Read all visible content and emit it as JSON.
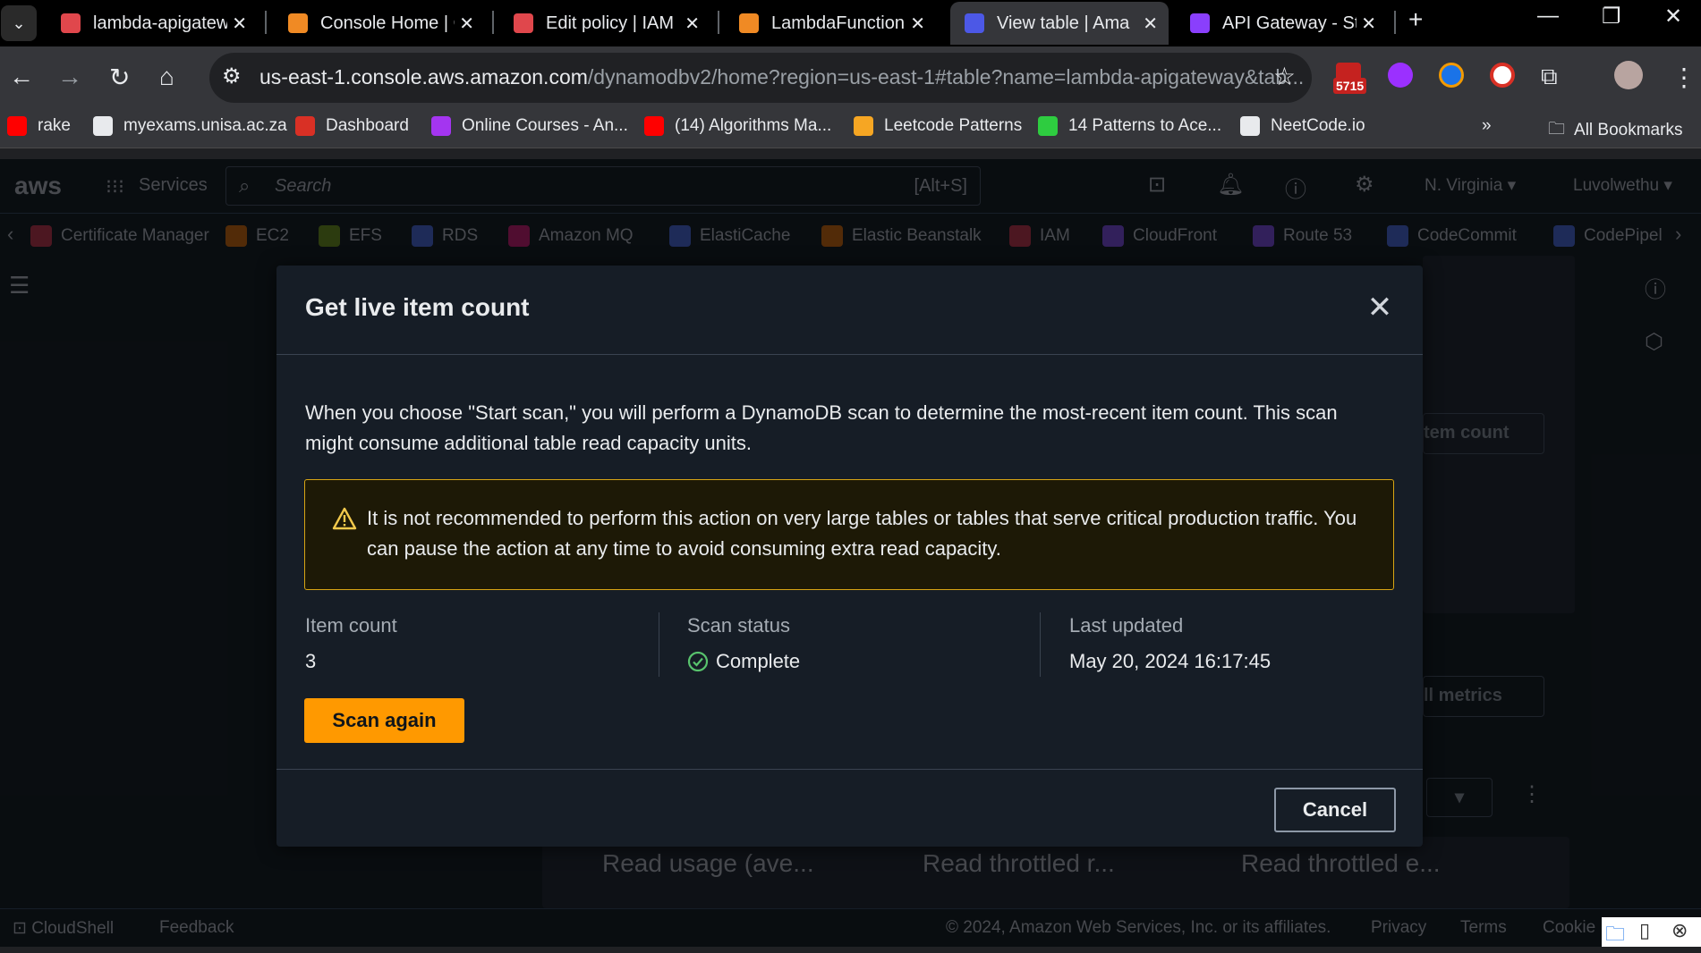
{
  "browser": {
    "tabs": [
      {
        "title": "lambda-apigatew",
        "color": "#e0474c"
      },
      {
        "title": "Console Home | C",
        "color": "#f08a24"
      },
      {
        "title": "Edit policy | IAM",
        "color": "#e0474c"
      },
      {
        "title": "LambdaFunction",
        "color": "#f08a24"
      },
      {
        "title": "View table | Ama",
        "color": "#4c58e6"
      },
      {
        "title": "API Gateway - St",
        "color": "#8a3ffc"
      }
    ],
    "url_host": "us-east-1.console.aws.amazon.com",
    "url_rest": "/dynamodbv2/home?region=us-east-1#table?name=lambda-apigateway&tab...",
    "badge": "5715",
    "bookmarks": [
      {
        "label": "rake",
        "color": "#ff0000"
      },
      {
        "label": "myexams.unisa.ac.za",
        "color": "#e8eaed"
      },
      {
        "label": "Dashboard",
        "color": "#d93025"
      },
      {
        "label": "Online Courses - An...",
        "color": "#a435f0"
      },
      {
        "label": "(14) Algorithms Ma...",
        "color": "#ff0000"
      },
      {
        "label": "Leetcode Patterns",
        "color": "#f6a623"
      },
      {
        "label": "14 Patterns to Ace...",
        "color": "#2ecc40"
      },
      {
        "label": "NeetCode.io",
        "color": "#e8eaed"
      }
    ],
    "all_bookmarks": "All Bookmarks"
  },
  "aws": {
    "services_label": "Services",
    "search_placeholder": "Search",
    "search_shortcut": "[Alt+S]",
    "region": "N. Virginia",
    "user": "Luvolwethu",
    "services": [
      {
        "label": "Certificate Manager",
        "color": "#dd344c"
      },
      {
        "label": "EC2",
        "color": "#ed7100"
      },
      {
        "label": "EFS",
        "color": "#7aa116"
      },
      {
        "label": "RDS",
        "color": "#4d72f3"
      },
      {
        "label": "Amazon MQ",
        "color": "#e7157b"
      },
      {
        "label": "ElastiCache",
        "color": "#4d72f3"
      },
      {
        "label": "Elastic Beanstalk",
        "color": "#ed7100"
      },
      {
        "label": "IAM",
        "color": "#dd344c"
      },
      {
        "label": "CloudFront",
        "color": "#8c4fff"
      },
      {
        "label": "Route 53",
        "color": "#8c4fff"
      },
      {
        "label": "CodeCommit",
        "color": "#4d72f3"
      },
      {
        "label": "CodePipel",
        "color": "#4d72f3"
      }
    ],
    "bg_btn_item_count": "tem count",
    "bg_btn_metrics": "ll metrics",
    "bg_cards": [
      "Read usage (ave...",
      "Read throttled r...",
      "Read throttled e..."
    ],
    "footer": {
      "cloudshell": "CloudShell",
      "feedback": "Feedback",
      "copyright": "© 2024, Amazon Web Services, Inc. or its affiliates.",
      "privacy": "Privacy",
      "terms": "Terms",
      "cookie": "Cookie"
    }
  },
  "modal": {
    "title": "Get live item count",
    "description": "When you choose \"Start scan,\" you will perform a DynamoDB scan to determine the most-recent item count. This scan might consume additional table read capacity units.",
    "alert": "It is not recommended to perform this action on very large tables or tables that serve critical production traffic. You can pause the action at any time to avoid consuming extra read capacity.",
    "item_count_label": "Item count",
    "item_count_value": "3",
    "scan_status_label": "Scan status",
    "scan_status_value": "Complete",
    "last_updated_label": "Last updated",
    "last_updated_value": "May 20, 2024 16:17:45",
    "scan_again": "Scan again",
    "cancel": "Cancel"
  }
}
